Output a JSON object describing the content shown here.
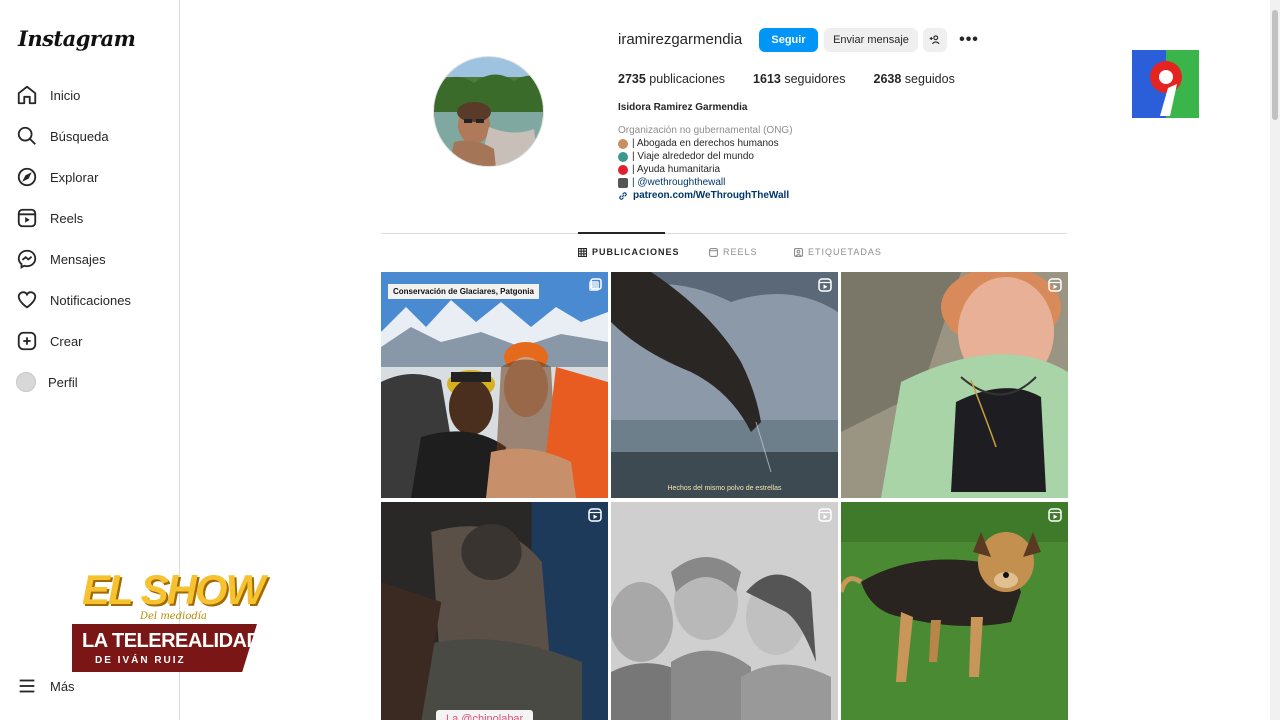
{
  "app": {
    "logo": "Instagram"
  },
  "sidebar": {
    "items": [
      {
        "label": "Inicio",
        "icon": "home-icon"
      },
      {
        "label": "Búsqueda",
        "icon": "search-icon"
      },
      {
        "label": "Explorar",
        "icon": "compass-icon"
      },
      {
        "label": "Reels",
        "icon": "reels-icon"
      },
      {
        "label": "Mensajes",
        "icon": "messenger-icon"
      },
      {
        "label": "Notificaciones",
        "icon": "heart-icon"
      },
      {
        "label": "Crear",
        "icon": "plus-square-icon"
      },
      {
        "label": "Perfil",
        "icon": "avatar"
      }
    ],
    "more": {
      "label": "Más",
      "icon": "menu-icon"
    }
  },
  "profile": {
    "username": "iramirezgarmendia",
    "follow_label": "Seguir",
    "message_label": "Enviar mensaje",
    "stats": {
      "posts_count": "2735",
      "posts_label": "publicaciones",
      "followers_count": "1613",
      "followers_label": "seguidores",
      "following_count": "2638",
      "following_label": "seguidos"
    },
    "full_name": "Isidora Ramirez Garmendia",
    "category": "Organización no gubernamental (ONG)",
    "bio_lines": [
      "| Abogada en derechos humanos",
      "| Viaje alrededor del mundo",
      "| Ayuda humanitaria",
      "| @wethroughthewall"
    ],
    "link": "patreon.com/WeThroughTheWall"
  },
  "tabs": [
    {
      "label": "PUBLICACIONES",
      "active": true
    },
    {
      "label": "REELS",
      "active": false
    },
    {
      "label": "ETIQUETADAS",
      "active": false
    }
  ],
  "posts": {
    "p1_caption": "Conservación de Glaciares, Patgonia",
    "p2_subtitle": "Hechos del mismo polvo de estrellas",
    "p4_tag": "La @chinolabar"
  },
  "overlays": {
    "show_title": "EL SHOW",
    "show_subtitle": "Del mediodía",
    "banner_line1": "LA TELEREALIDAD",
    "banner_line2": "DE IVÁN RUIZ"
  },
  "colors": {
    "accent": "#0095f6",
    "channel_red": "#e52421",
    "channel_blue": "#2b5fd9",
    "channel_green": "#3ab54a"
  }
}
